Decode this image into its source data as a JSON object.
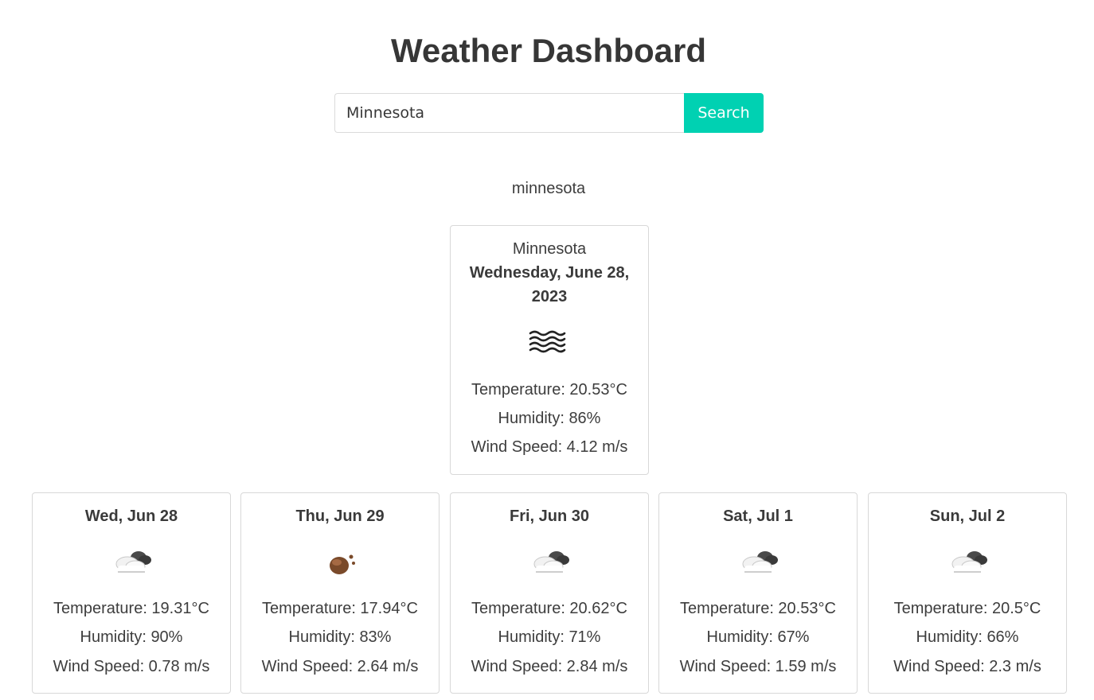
{
  "header": {
    "title": "Weather Dashboard"
  },
  "search": {
    "value": "Minnesota",
    "button_label": "Search"
  },
  "query_label": "minnesota",
  "current": {
    "city": "Minnesota",
    "date_line1": "Wednesday, June 28,",
    "date_line2": "2023",
    "icon": "mist-icon",
    "temperature": "Temperature: 20.53°C",
    "humidity": "Humidity: 86%",
    "wind": "Wind Speed: 4.12 m/s"
  },
  "forecast": [
    {
      "day": "Wed, Jun 28",
      "icon": "broken-clouds-icon",
      "temperature": "Temperature: 19.31°C",
      "humidity": "Humidity: 90%",
      "wind": "Wind Speed: 0.78 m/s"
    },
    {
      "day": "Thu, Jun 29",
      "icon": "rain-drop-icon",
      "temperature": "Temperature: 17.94°C",
      "humidity": "Humidity: 83%",
      "wind": "Wind Speed: 2.64 m/s"
    },
    {
      "day": "Fri, Jun 30",
      "icon": "broken-clouds-icon",
      "temperature": "Temperature: 20.62°C",
      "humidity": "Humidity: 71%",
      "wind": "Wind Speed: 2.84 m/s"
    },
    {
      "day": "Sat, Jul 1",
      "icon": "broken-clouds-icon",
      "temperature": "Temperature: 20.53°C",
      "humidity": "Humidity: 67%",
      "wind": "Wind Speed: 1.59 m/s"
    },
    {
      "day": "Sun, Jul 2",
      "icon": "broken-clouds-icon",
      "temperature": "Temperature: 20.5°C",
      "humidity": "Humidity: 66%",
      "wind": "Wind Speed: 2.3 m/s"
    }
  ],
  "colors": {
    "accent": "#00d1b2",
    "text": "#3d3d3d",
    "border": "#d8d8d8"
  }
}
